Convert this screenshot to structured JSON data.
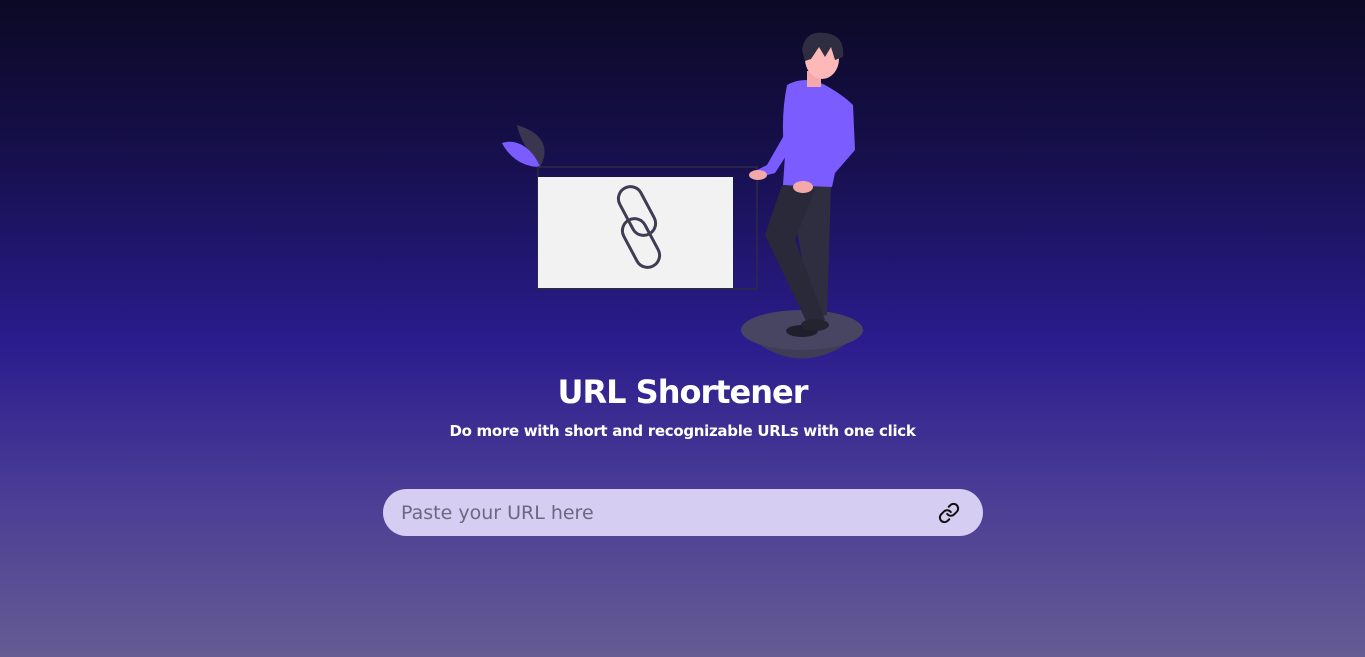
{
  "header": {
    "title": "URL Shortener",
    "subtitle": "Do more with short and recognizable URLs with one click"
  },
  "form": {
    "input_placeholder": "Paste your URL here",
    "input_value": "",
    "submit_icon": "link-icon"
  },
  "colors": {
    "accent_purple": "#7b5cff",
    "input_background": "#d6cdf2"
  }
}
